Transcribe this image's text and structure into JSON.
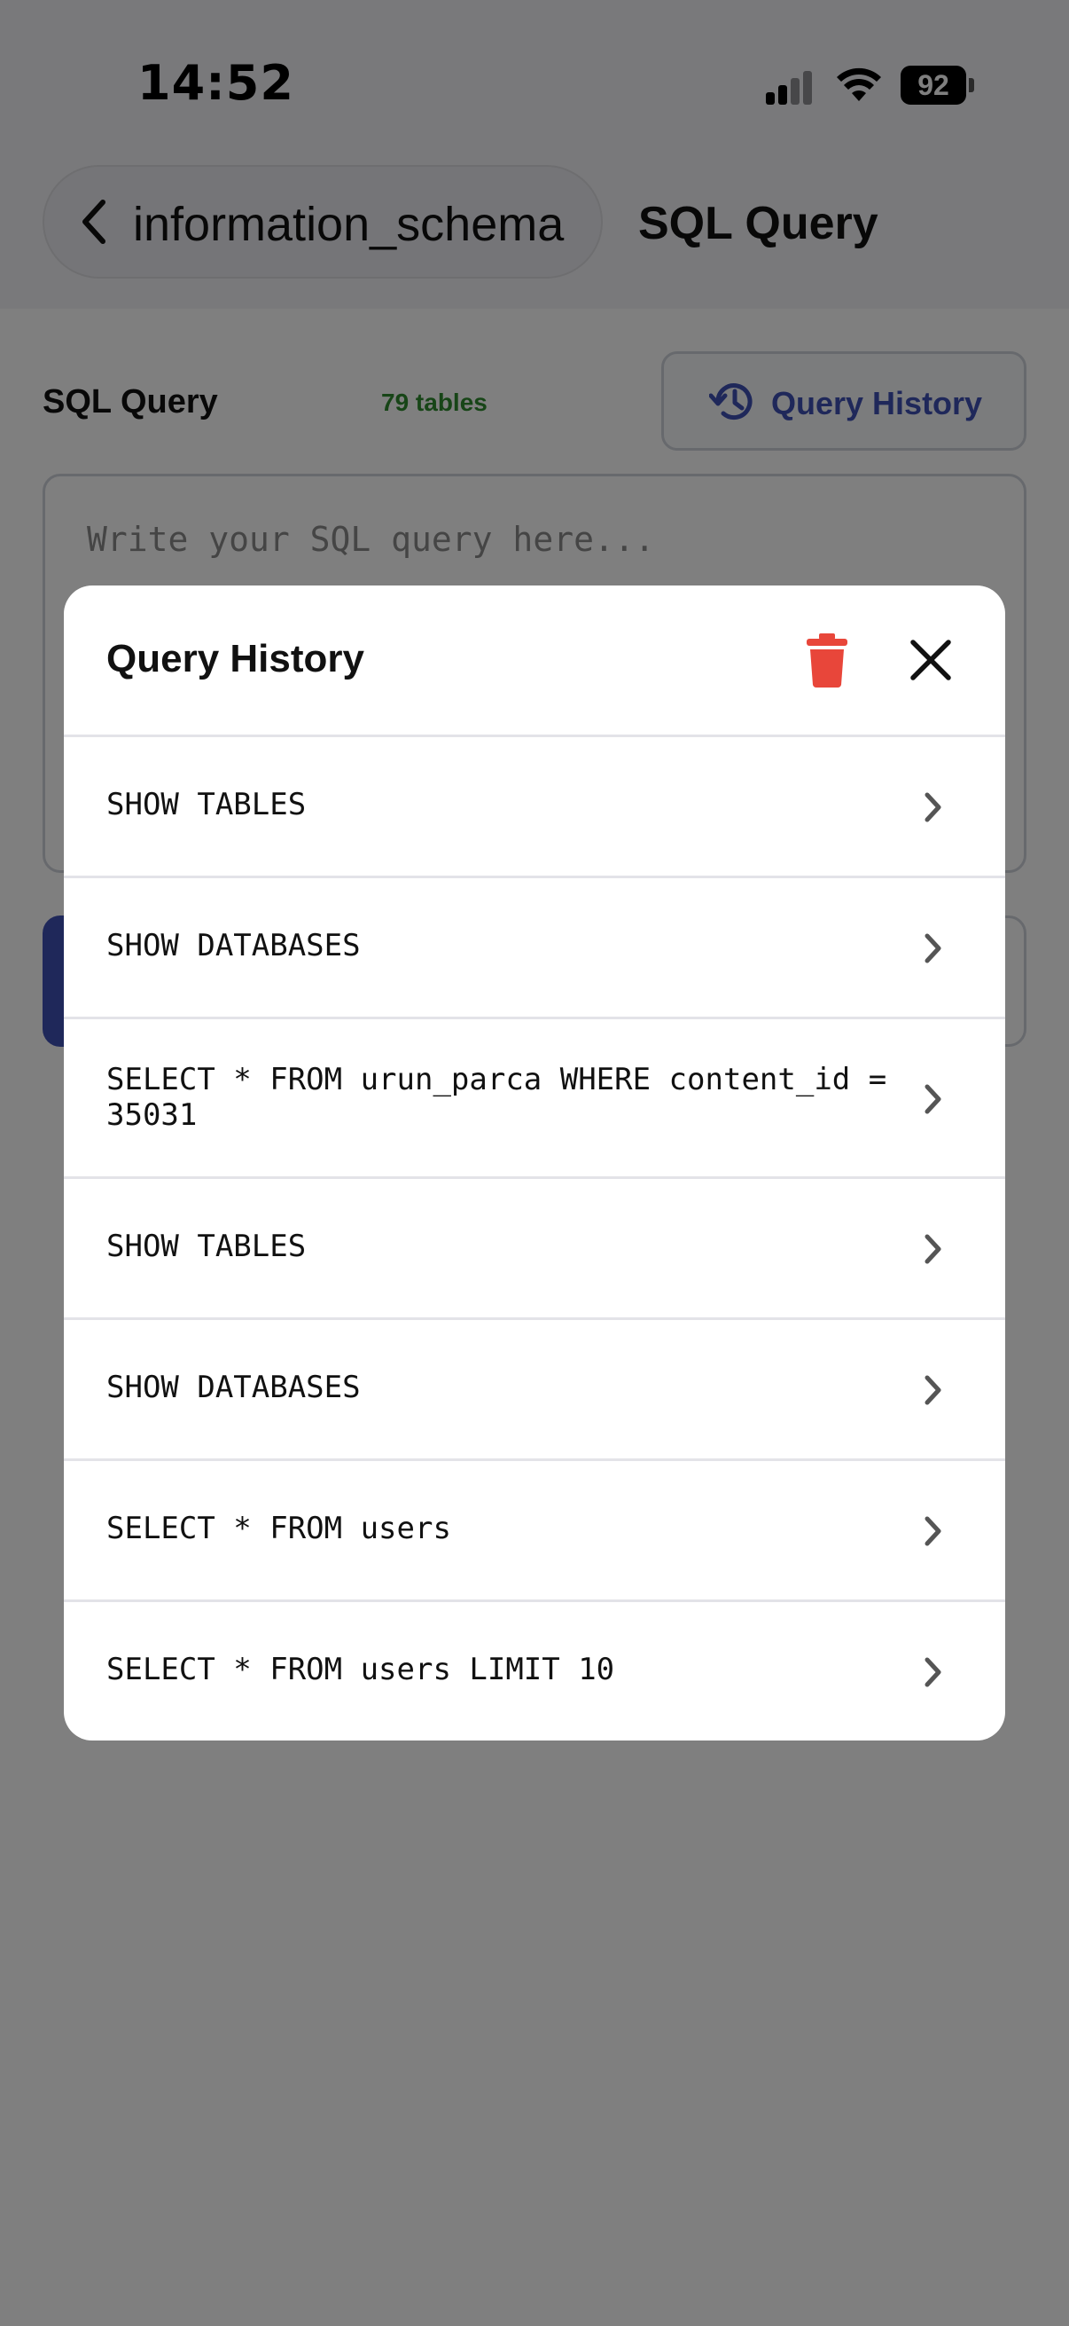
{
  "status_bar": {
    "time": "14:52",
    "battery": "92"
  },
  "nav": {
    "back_label": "information_schema",
    "title": "SQL Query"
  },
  "query_panel": {
    "label": "SQL Query",
    "tables_count": "79 tables",
    "history_button_label": "Query History",
    "editor_placeholder": "Write your SQL query here..."
  },
  "modal": {
    "title": "Query History",
    "items": [
      {
        "query": "SHOW TABLES"
      },
      {
        "query": "SHOW DATABASES"
      },
      {
        "query": "SELECT * FROM urun_parca WHERE content_id = 35031"
      },
      {
        "query": "SHOW TABLES"
      },
      {
        "query": "SHOW DATABASES"
      },
      {
        "query": "SELECT * FROM users"
      },
      {
        "query": "SELECT * FROM users LIMIT 10"
      }
    ]
  },
  "colors": {
    "accent": "#3f51b5",
    "delete": "#e8463a",
    "success": "#2e8b2e"
  }
}
